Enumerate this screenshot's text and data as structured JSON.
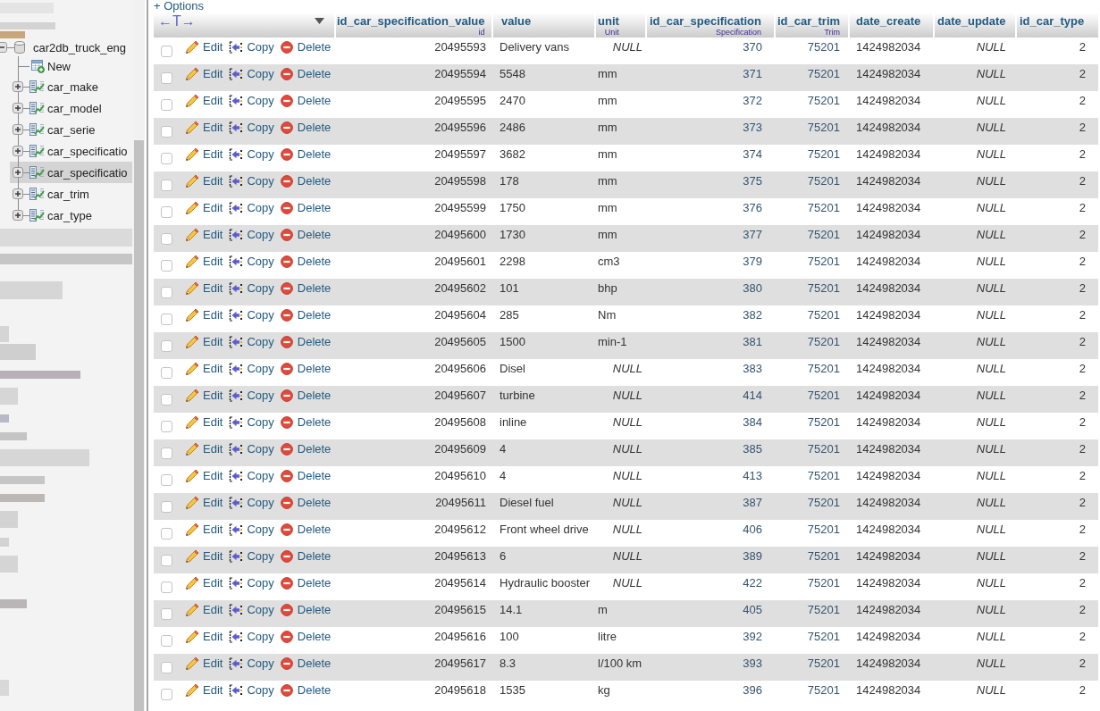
{
  "options_link": "+ Options",
  "sidebar": {
    "database": {
      "name": "car2db_truck_eng",
      "expanded": true
    },
    "items": [
      {
        "kind": "new",
        "label": "New",
        "selected": false
      },
      {
        "kind": "table",
        "label": "car_make",
        "expanded": false,
        "selected": false
      },
      {
        "kind": "table",
        "label": "car_model",
        "expanded": false,
        "selected": false
      },
      {
        "kind": "table",
        "label": "car_serie",
        "expanded": false,
        "selected": false
      },
      {
        "kind": "table",
        "label": "car_specificatio",
        "expanded": false,
        "selected": false
      },
      {
        "kind": "table",
        "label": "car_specificatio",
        "expanded": false,
        "selected": true
      },
      {
        "kind": "table",
        "label": "car_trim",
        "expanded": false,
        "selected": false
      },
      {
        "kind": "table",
        "label": "car_type",
        "expanded": false,
        "selected": false
      }
    ]
  },
  "table": {
    "text_toggle": "←T→",
    "columns": [
      {
        "name": "id_car_specification_value",
        "comment": "id",
        "kind": "number"
      },
      {
        "name": "value",
        "kind": "text"
      },
      {
        "name": "unit",
        "comment": "Unit",
        "kind": "text"
      },
      {
        "name": "id_car_specification",
        "comment": "Specification",
        "kind": "link"
      },
      {
        "name": "id_car_trim",
        "comment": "Trim",
        "kind": "link"
      },
      {
        "name": "date_create",
        "kind": "text"
      },
      {
        "name": "date_update",
        "kind": "text"
      },
      {
        "name": "id_car_type",
        "kind": "number"
      }
    ],
    "rows": [
      {
        "checked": false,
        "actions": [
          "Edit",
          "Copy",
          "Delete"
        ],
        "cells": [
          {
            "text": "20495593",
            "null": false
          },
          {
            "text": "Delivery vans",
            "null": false
          },
          {
            "text": "NULL",
            "null": true
          },
          {
            "text": "370",
            "null": false
          },
          {
            "text": "75201",
            "null": false
          },
          {
            "text": "1424982034",
            "null": false
          },
          {
            "text": "NULL",
            "null": true
          },
          {
            "text": "2",
            "null": false
          }
        ]
      },
      {
        "checked": false,
        "actions": [
          "Edit",
          "Copy",
          "Delete"
        ],
        "cells": [
          {
            "text": "20495594",
            "null": false
          },
          {
            "text": "5548",
            "null": false
          },
          {
            "text": "mm",
            "null": false
          },
          {
            "text": "371",
            "null": false
          },
          {
            "text": "75201",
            "null": false
          },
          {
            "text": "1424982034",
            "null": false
          },
          {
            "text": "NULL",
            "null": true
          },
          {
            "text": "2",
            "null": false
          }
        ]
      },
      {
        "checked": false,
        "actions": [
          "Edit",
          "Copy",
          "Delete"
        ],
        "cells": [
          {
            "text": "20495595",
            "null": false
          },
          {
            "text": "2470",
            "null": false
          },
          {
            "text": "mm",
            "null": false
          },
          {
            "text": "372",
            "null": false
          },
          {
            "text": "75201",
            "null": false
          },
          {
            "text": "1424982034",
            "null": false
          },
          {
            "text": "NULL",
            "null": true
          },
          {
            "text": "2",
            "null": false
          }
        ]
      },
      {
        "checked": false,
        "actions": [
          "Edit",
          "Copy",
          "Delete"
        ],
        "cells": [
          {
            "text": "20495596",
            "null": false
          },
          {
            "text": "2486",
            "null": false
          },
          {
            "text": "mm",
            "null": false
          },
          {
            "text": "373",
            "null": false
          },
          {
            "text": "75201",
            "null": false
          },
          {
            "text": "1424982034",
            "null": false
          },
          {
            "text": "NULL",
            "null": true
          },
          {
            "text": "2",
            "null": false
          }
        ]
      },
      {
        "checked": false,
        "actions": [
          "Edit",
          "Copy",
          "Delete"
        ],
        "cells": [
          {
            "text": "20495597",
            "null": false
          },
          {
            "text": "3682",
            "null": false
          },
          {
            "text": "mm",
            "null": false
          },
          {
            "text": "374",
            "null": false
          },
          {
            "text": "75201",
            "null": false
          },
          {
            "text": "1424982034",
            "null": false
          },
          {
            "text": "NULL",
            "null": true
          },
          {
            "text": "2",
            "null": false
          }
        ]
      },
      {
        "checked": false,
        "actions": [
          "Edit",
          "Copy",
          "Delete"
        ],
        "cells": [
          {
            "text": "20495598",
            "null": false
          },
          {
            "text": "178",
            "null": false
          },
          {
            "text": "mm",
            "null": false
          },
          {
            "text": "375",
            "null": false
          },
          {
            "text": "75201",
            "null": false
          },
          {
            "text": "1424982034",
            "null": false
          },
          {
            "text": "NULL",
            "null": true
          },
          {
            "text": "2",
            "null": false
          }
        ]
      },
      {
        "checked": false,
        "actions": [
          "Edit",
          "Copy",
          "Delete"
        ],
        "cells": [
          {
            "text": "20495599",
            "null": false
          },
          {
            "text": "1750",
            "null": false
          },
          {
            "text": "mm",
            "null": false
          },
          {
            "text": "376",
            "null": false
          },
          {
            "text": "75201",
            "null": false
          },
          {
            "text": "1424982034",
            "null": false
          },
          {
            "text": "NULL",
            "null": true
          },
          {
            "text": "2",
            "null": false
          }
        ]
      },
      {
        "checked": false,
        "actions": [
          "Edit",
          "Copy",
          "Delete"
        ],
        "cells": [
          {
            "text": "20495600",
            "null": false
          },
          {
            "text": "1730",
            "null": false
          },
          {
            "text": "mm",
            "null": false
          },
          {
            "text": "377",
            "null": false
          },
          {
            "text": "75201",
            "null": false
          },
          {
            "text": "1424982034",
            "null": false
          },
          {
            "text": "NULL",
            "null": true
          },
          {
            "text": "2",
            "null": false
          }
        ]
      },
      {
        "checked": false,
        "actions": [
          "Edit",
          "Copy",
          "Delete"
        ],
        "cells": [
          {
            "text": "20495601",
            "null": false
          },
          {
            "text": "2298",
            "null": false
          },
          {
            "text": "cm3",
            "null": false
          },
          {
            "text": "379",
            "null": false
          },
          {
            "text": "75201",
            "null": false
          },
          {
            "text": "1424982034",
            "null": false
          },
          {
            "text": "NULL",
            "null": true
          },
          {
            "text": "2",
            "null": false
          }
        ]
      },
      {
        "checked": false,
        "actions": [
          "Edit",
          "Copy",
          "Delete"
        ],
        "cells": [
          {
            "text": "20495602",
            "null": false
          },
          {
            "text": "101",
            "null": false
          },
          {
            "text": "bhp",
            "null": false
          },
          {
            "text": "380",
            "null": false
          },
          {
            "text": "75201",
            "null": false
          },
          {
            "text": "1424982034",
            "null": false
          },
          {
            "text": "NULL",
            "null": true
          },
          {
            "text": "2",
            "null": false
          }
        ]
      },
      {
        "checked": false,
        "actions": [
          "Edit",
          "Copy",
          "Delete"
        ],
        "cells": [
          {
            "text": "20495604",
            "null": false
          },
          {
            "text": "285",
            "null": false
          },
          {
            "text": "Nm",
            "null": false
          },
          {
            "text": "382",
            "null": false
          },
          {
            "text": "75201",
            "null": false
          },
          {
            "text": "1424982034",
            "null": false
          },
          {
            "text": "NULL",
            "null": true
          },
          {
            "text": "2",
            "null": false
          }
        ]
      },
      {
        "checked": false,
        "actions": [
          "Edit",
          "Copy",
          "Delete"
        ],
        "cells": [
          {
            "text": "20495605",
            "null": false
          },
          {
            "text": "1500",
            "null": false
          },
          {
            "text": "min-1",
            "null": false
          },
          {
            "text": "381",
            "null": false
          },
          {
            "text": "75201",
            "null": false
          },
          {
            "text": "1424982034",
            "null": false
          },
          {
            "text": "NULL",
            "null": true
          },
          {
            "text": "2",
            "null": false
          }
        ]
      },
      {
        "checked": false,
        "actions": [
          "Edit",
          "Copy",
          "Delete"
        ],
        "cells": [
          {
            "text": "20495606",
            "null": false
          },
          {
            "text": "Disel",
            "null": false
          },
          {
            "text": "NULL",
            "null": true
          },
          {
            "text": "383",
            "null": false
          },
          {
            "text": "75201",
            "null": false
          },
          {
            "text": "1424982034",
            "null": false
          },
          {
            "text": "NULL",
            "null": true
          },
          {
            "text": "2",
            "null": false
          }
        ]
      },
      {
        "checked": false,
        "actions": [
          "Edit",
          "Copy",
          "Delete"
        ],
        "cells": [
          {
            "text": "20495607",
            "null": false
          },
          {
            "text": "turbine",
            "null": false
          },
          {
            "text": "NULL",
            "null": true
          },
          {
            "text": "414",
            "null": false
          },
          {
            "text": "75201",
            "null": false
          },
          {
            "text": "1424982034",
            "null": false
          },
          {
            "text": "NULL",
            "null": true
          },
          {
            "text": "2",
            "null": false
          }
        ]
      },
      {
        "checked": false,
        "actions": [
          "Edit",
          "Copy",
          "Delete"
        ],
        "cells": [
          {
            "text": "20495608",
            "null": false
          },
          {
            "text": "inline",
            "null": false
          },
          {
            "text": "NULL",
            "null": true
          },
          {
            "text": "384",
            "null": false
          },
          {
            "text": "75201",
            "null": false
          },
          {
            "text": "1424982034",
            "null": false
          },
          {
            "text": "NULL",
            "null": true
          },
          {
            "text": "2",
            "null": false
          }
        ]
      },
      {
        "checked": false,
        "actions": [
          "Edit",
          "Copy",
          "Delete"
        ],
        "cells": [
          {
            "text": "20495609",
            "null": false
          },
          {
            "text": "4",
            "null": false
          },
          {
            "text": "NULL",
            "null": true
          },
          {
            "text": "385",
            "null": false
          },
          {
            "text": "75201",
            "null": false
          },
          {
            "text": "1424982034",
            "null": false
          },
          {
            "text": "NULL",
            "null": true
          },
          {
            "text": "2",
            "null": false
          }
        ]
      },
      {
        "checked": false,
        "actions": [
          "Edit",
          "Copy",
          "Delete"
        ],
        "cells": [
          {
            "text": "20495610",
            "null": false
          },
          {
            "text": "4",
            "null": false
          },
          {
            "text": "NULL",
            "null": true
          },
          {
            "text": "413",
            "null": false
          },
          {
            "text": "75201",
            "null": false
          },
          {
            "text": "1424982034",
            "null": false
          },
          {
            "text": "NULL",
            "null": true
          },
          {
            "text": "2",
            "null": false
          }
        ]
      },
      {
        "checked": false,
        "actions": [
          "Edit",
          "Copy",
          "Delete"
        ],
        "cells": [
          {
            "text": "20495611",
            "null": false
          },
          {
            "text": "Diesel fuel",
            "null": false
          },
          {
            "text": "NULL",
            "null": true
          },
          {
            "text": "387",
            "null": false
          },
          {
            "text": "75201",
            "null": false
          },
          {
            "text": "1424982034",
            "null": false
          },
          {
            "text": "NULL",
            "null": true
          },
          {
            "text": "2",
            "null": false
          }
        ]
      },
      {
        "checked": false,
        "actions": [
          "Edit",
          "Copy",
          "Delete"
        ],
        "cells": [
          {
            "text": "20495612",
            "null": false
          },
          {
            "text": "Front wheel drive",
            "null": false
          },
          {
            "text": "NULL",
            "null": true
          },
          {
            "text": "406",
            "null": false
          },
          {
            "text": "75201",
            "null": false
          },
          {
            "text": "1424982034",
            "null": false
          },
          {
            "text": "NULL",
            "null": true
          },
          {
            "text": "2",
            "null": false
          }
        ]
      },
      {
        "checked": false,
        "actions": [
          "Edit",
          "Copy",
          "Delete"
        ],
        "cells": [
          {
            "text": "20495613",
            "null": false
          },
          {
            "text": "6",
            "null": false
          },
          {
            "text": "NULL",
            "null": true
          },
          {
            "text": "389",
            "null": false
          },
          {
            "text": "75201",
            "null": false
          },
          {
            "text": "1424982034",
            "null": false
          },
          {
            "text": "NULL",
            "null": true
          },
          {
            "text": "2",
            "null": false
          }
        ]
      },
      {
        "checked": false,
        "actions": [
          "Edit",
          "Copy",
          "Delete"
        ],
        "cells": [
          {
            "text": "20495614",
            "null": false
          },
          {
            "text": "Hydraulic booster",
            "null": false
          },
          {
            "text": "NULL",
            "null": true
          },
          {
            "text": "422",
            "null": false
          },
          {
            "text": "75201",
            "null": false
          },
          {
            "text": "1424982034",
            "null": false
          },
          {
            "text": "NULL",
            "null": true
          },
          {
            "text": "2",
            "null": false
          }
        ]
      },
      {
        "checked": false,
        "actions": [
          "Edit",
          "Copy",
          "Delete"
        ],
        "cells": [
          {
            "text": "20495615",
            "null": false
          },
          {
            "text": "14.1",
            "null": false
          },
          {
            "text": "m",
            "null": false
          },
          {
            "text": "405",
            "null": false
          },
          {
            "text": "75201",
            "null": false
          },
          {
            "text": "1424982034",
            "null": false
          },
          {
            "text": "NULL",
            "null": true
          },
          {
            "text": "2",
            "null": false
          }
        ]
      },
      {
        "checked": false,
        "actions": [
          "Edit",
          "Copy",
          "Delete"
        ],
        "cells": [
          {
            "text": "20495616",
            "null": false
          },
          {
            "text": "100",
            "null": false
          },
          {
            "text": "litre",
            "null": false
          },
          {
            "text": "392",
            "null": false
          },
          {
            "text": "75201",
            "null": false
          },
          {
            "text": "1424982034",
            "null": false
          },
          {
            "text": "NULL",
            "null": true
          },
          {
            "text": "2",
            "null": false
          }
        ]
      },
      {
        "checked": false,
        "actions": [
          "Edit",
          "Copy",
          "Delete"
        ],
        "cells": [
          {
            "text": "20495617",
            "null": false
          },
          {
            "text": "8.3",
            "null": false
          },
          {
            "text": "l/100 km",
            "null": false
          },
          {
            "text": "393",
            "null": false
          },
          {
            "text": "75201",
            "null": false
          },
          {
            "text": "1424982034",
            "null": false
          },
          {
            "text": "NULL",
            "null": true
          },
          {
            "text": "2",
            "null": false
          }
        ]
      },
      {
        "checked": false,
        "actions": [
          "Edit",
          "Copy",
          "Delete"
        ],
        "cells": [
          {
            "text": "20495618",
            "null": false
          },
          {
            "text": "1535",
            "null": false
          },
          {
            "text": "kg",
            "null": false
          },
          {
            "text": "396",
            "null": false
          },
          {
            "text": "75201",
            "null": false
          },
          {
            "text": "1424982034",
            "null": false
          },
          {
            "text": "NULL",
            "null": true
          },
          {
            "text": "2",
            "null": false
          }
        ]
      }
    ]
  }
}
